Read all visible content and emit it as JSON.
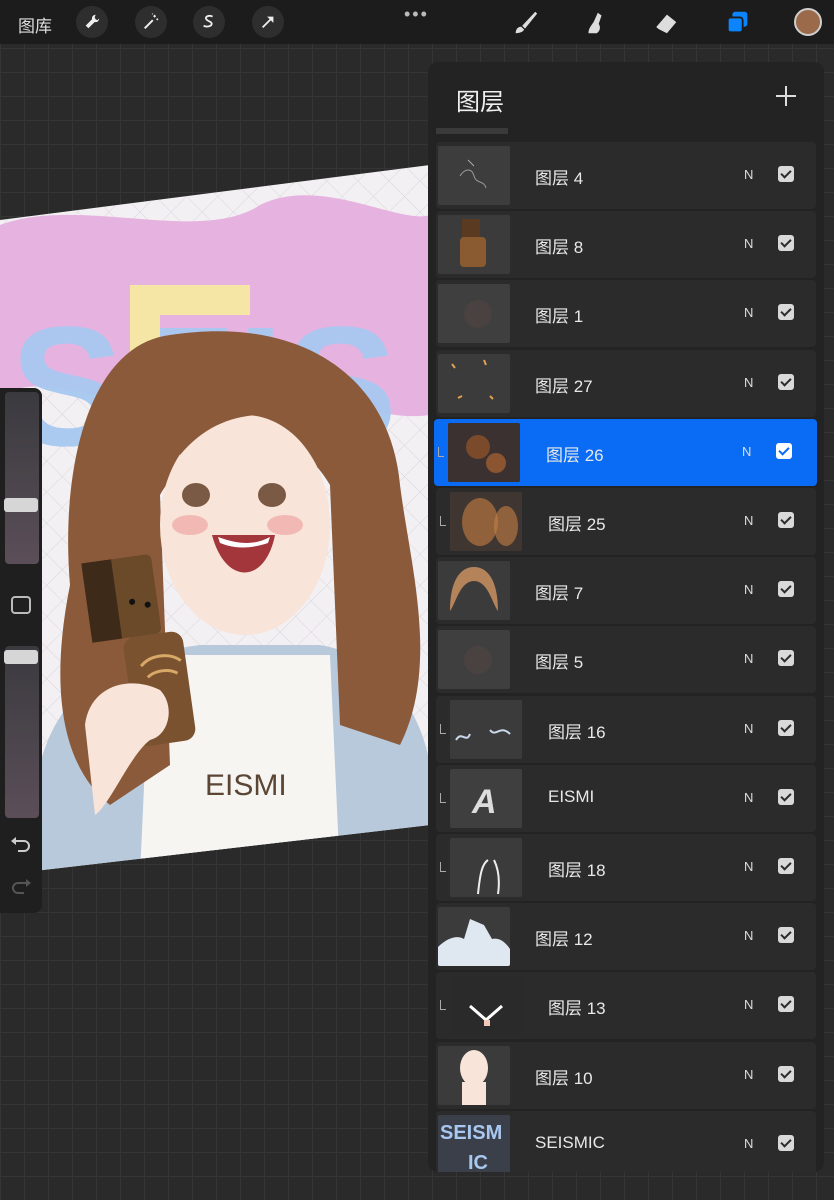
{
  "toolbar": {
    "gallery_label": "图库",
    "left_tools": [
      "wrench-icon",
      "magic-wand-icon",
      "selection-icon",
      "transform-arrow-icon"
    ],
    "right_tools": [
      "brush-icon",
      "smudge-icon",
      "eraser-icon",
      "layers-icon"
    ],
    "more_label": "•••",
    "current_color": "#9a6a4a"
  },
  "sidebar": {
    "undo_icon": "undo-icon",
    "redo_icon": "redo-icon"
  },
  "artwork": {
    "shirt_text": "EISMI",
    "bg_letters": "SEIS"
  },
  "layers_panel": {
    "title": "图层",
    "add_label": "+",
    "layers": [
      {
        "name": "图层 4",
        "blend": "N",
        "visible": true,
        "clipped": false,
        "selected": false,
        "thumb": "sketch"
      },
      {
        "name": "图层 8",
        "blend": "N",
        "visible": true,
        "clipped": false,
        "selected": false,
        "thumb": "doll"
      },
      {
        "name": "图层 1",
        "blend": "N",
        "visible": true,
        "clipped": false,
        "selected": false,
        "thumb": "dark"
      },
      {
        "name": "图层 27",
        "blend": "N",
        "visible": true,
        "clipped": false,
        "selected": false,
        "thumb": "sparks"
      },
      {
        "name": "图层 26",
        "blend": "N",
        "visible": true,
        "clipped": true,
        "selected": true,
        "thumb": "brown"
      },
      {
        "name": "图层 25",
        "blend": "N",
        "visible": true,
        "clipped": true,
        "selected": false,
        "thumb": "orange"
      },
      {
        "name": "图层 7",
        "blend": "N",
        "visible": true,
        "clipped": false,
        "selected": false,
        "thumb": "hair"
      },
      {
        "name": "图层 5",
        "blend": "N",
        "visible": true,
        "clipped": false,
        "selected": false,
        "thumb": "dark"
      },
      {
        "name": "图层 16",
        "blend": "N",
        "visible": true,
        "clipped": true,
        "selected": false,
        "thumb": "lines"
      },
      {
        "name": "EISMI",
        "blend": "N",
        "visible": true,
        "clipped": true,
        "selected": false,
        "thumb": "text"
      },
      {
        "name": "图层 18",
        "blend": "N",
        "visible": true,
        "clipped": true,
        "selected": false,
        "thumb": "whitelines"
      },
      {
        "name": "图层 12",
        "blend": "N",
        "visible": true,
        "clipped": false,
        "selected": false,
        "thumb": "jacket"
      },
      {
        "name": "图层 13",
        "blend": "N",
        "visible": true,
        "clipped": true,
        "selected": false,
        "thumb": "collar"
      },
      {
        "name": "图层 10",
        "blend": "N",
        "visible": true,
        "clipped": false,
        "selected": false,
        "thumb": "skin"
      },
      {
        "name": "SEISMIC",
        "blend": "N",
        "visible": true,
        "clipped": false,
        "selected": false,
        "thumb": "seismic"
      }
    ],
    "seismic_thumb_text": [
      "SEISM",
      "IC"
    ]
  }
}
